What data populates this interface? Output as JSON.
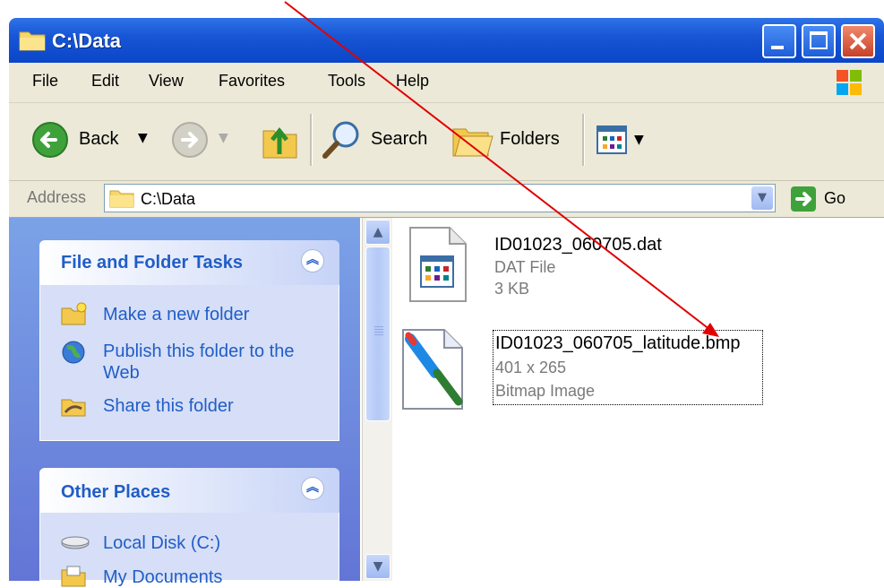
{
  "window": {
    "title": "C:\\Data",
    "controls": {
      "minimize": "minimize",
      "maximize": "maximize",
      "close": "close"
    }
  },
  "menu": [
    "File",
    "Edit",
    "View",
    "Favorites",
    "Tools",
    "Help"
  ],
  "toolbar": {
    "back_label": "Back",
    "search_label": "Search",
    "folders_label": "Folders"
  },
  "address": {
    "label": "Address",
    "value": "C:\\Data",
    "go_label": "Go"
  },
  "tasks_panel": {
    "title": "File and Folder Tasks",
    "items": [
      {
        "label": "Make a new folder",
        "icon": "new-folder-icon"
      },
      {
        "label": "Publish this folder to the Web",
        "icon": "globe-icon"
      },
      {
        "label": "Share this folder",
        "icon": "share-folder-icon"
      }
    ]
  },
  "places_panel": {
    "title": "Other Places",
    "items": [
      {
        "label": "Local Disk (C:)",
        "icon": "disk-icon"
      },
      {
        "label": "My Documents",
        "icon": "documents-icon"
      }
    ]
  },
  "files": [
    {
      "name": "ID01023_060705.dat",
      "line2": "DAT File",
      "line3": "3 KB",
      "icon": "dat-file-icon"
    },
    {
      "name": "ID01023_060705_latitude.bmp",
      "line2": "401 x 265",
      "line3": "Bitmap Image",
      "icon": "bitmap-paint-icon"
    }
  ],
  "colors": {
    "titlebar": "#0a46c8",
    "task_link": "#215dc6",
    "annotation_arrow": "#e00000"
  }
}
